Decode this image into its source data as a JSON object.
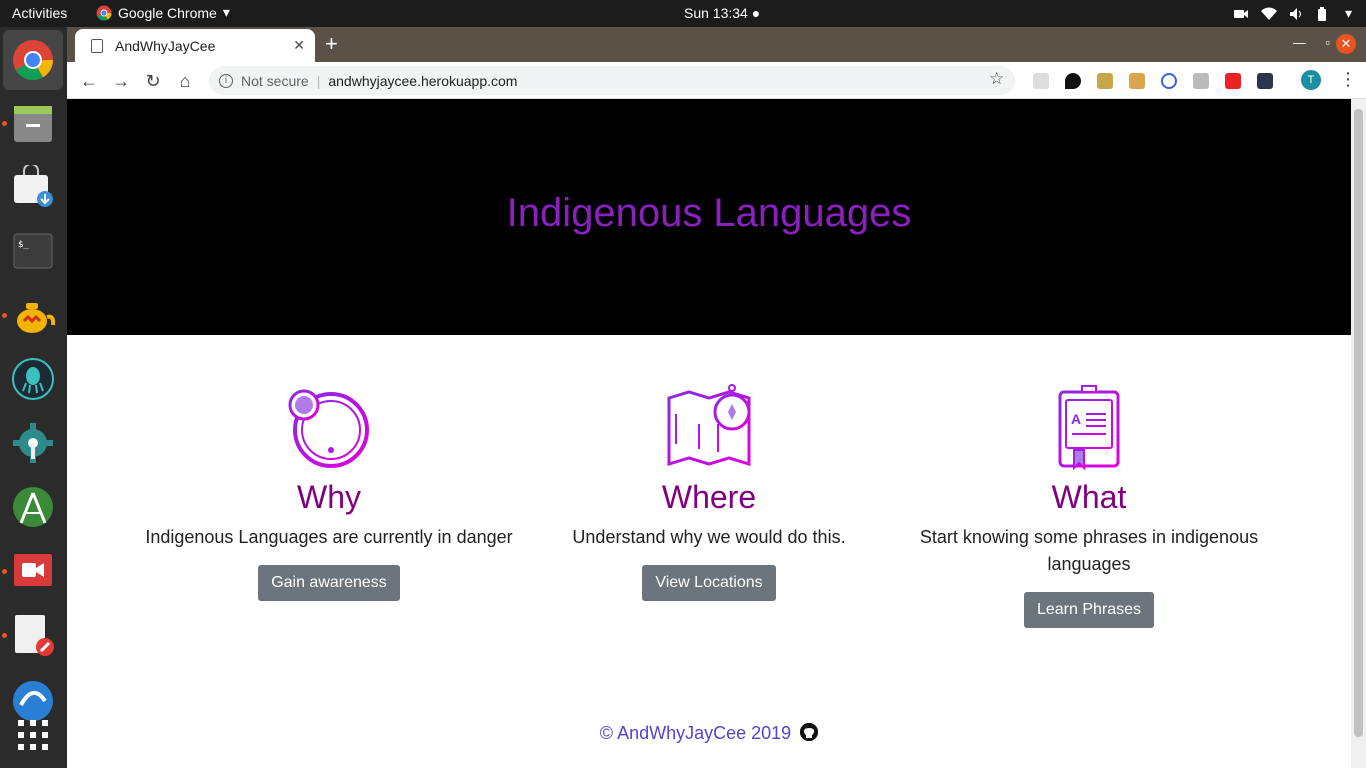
{
  "system_bar": {
    "activities": "Activities",
    "app_name": "Google Chrome",
    "clock": "Sun 13:34"
  },
  "browser": {
    "tab_title": "AndWhyJayCee",
    "new_tab": "+",
    "not_secure": "Not secure",
    "url": "andwhyjaycee.herokuapp.com",
    "profile_initial": "T"
  },
  "page": {
    "hero_title": "Indigenous Languages",
    "features": [
      {
        "title": "Why",
        "text": "Indigenous Languages are currently in danger",
        "button": "Gain awareness",
        "icon": "alert-circle-icon"
      },
      {
        "title": "Where",
        "text": "Understand why we would do this.",
        "button": "View Locations",
        "icon": "map-compass-icon"
      },
      {
        "title": "What",
        "text": "Start knowing some phrases in indigenous languages",
        "button": "Learn Phrases",
        "icon": "book-icon"
      }
    ],
    "footer": "© AndWhyJayCee 2019"
  },
  "colors": {
    "hero_title": "#8b1fbf",
    "feature_title": "#800080",
    "button_bg": "#6c757d",
    "footer_link": "#5a3fd1",
    "ubuntu_orange": "#e95420"
  }
}
